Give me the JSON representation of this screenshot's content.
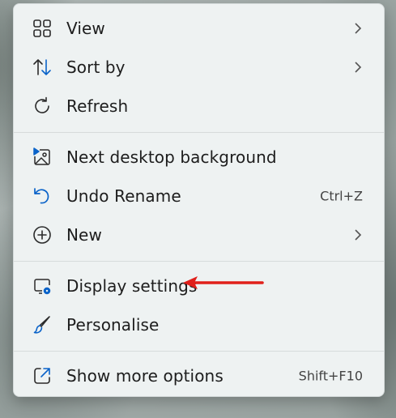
{
  "menu": {
    "groups": [
      {
        "items": [
          {
            "label": "View",
            "icon": "grid-icon",
            "submenu": true
          },
          {
            "label": "Sort by",
            "icon": "sort-icon",
            "submenu": true
          },
          {
            "label": "Refresh",
            "icon": "refresh-icon"
          }
        ]
      },
      {
        "items": [
          {
            "label": "Next desktop background",
            "icon": "next-background-icon"
          },
          {
            "label": "Undo Rename",
            "icon": "undo-icon",
            "shortcut": "Ctrl+Z"
          },
          {
            "label": "New",
            "icon": "add-circle-icon",
            "submenu": true
          }
        ]
      },
      {
        "items": [
          {
            "label": "Display settings",
            "icon": "display-settings-icon"
          },
          {
            "label": "Personalise",
            "icon": "brush-icon"
          }
        ]
      },
      {
        "items": [
          {
            "label": "Show more options",
            "icon": "open-external-icon",
            "shortcut": "Shift+F10"
          }
        ]
      }
    ]
  },
  "annotation": {
    "color": "#e0201b",
    "target": "Display settings"
  },
  "colors": {
    "accent": "#0a63c9",
    "menu_bg": "#eef2f2",
    "text": "#1d1d1d"
  }
}
